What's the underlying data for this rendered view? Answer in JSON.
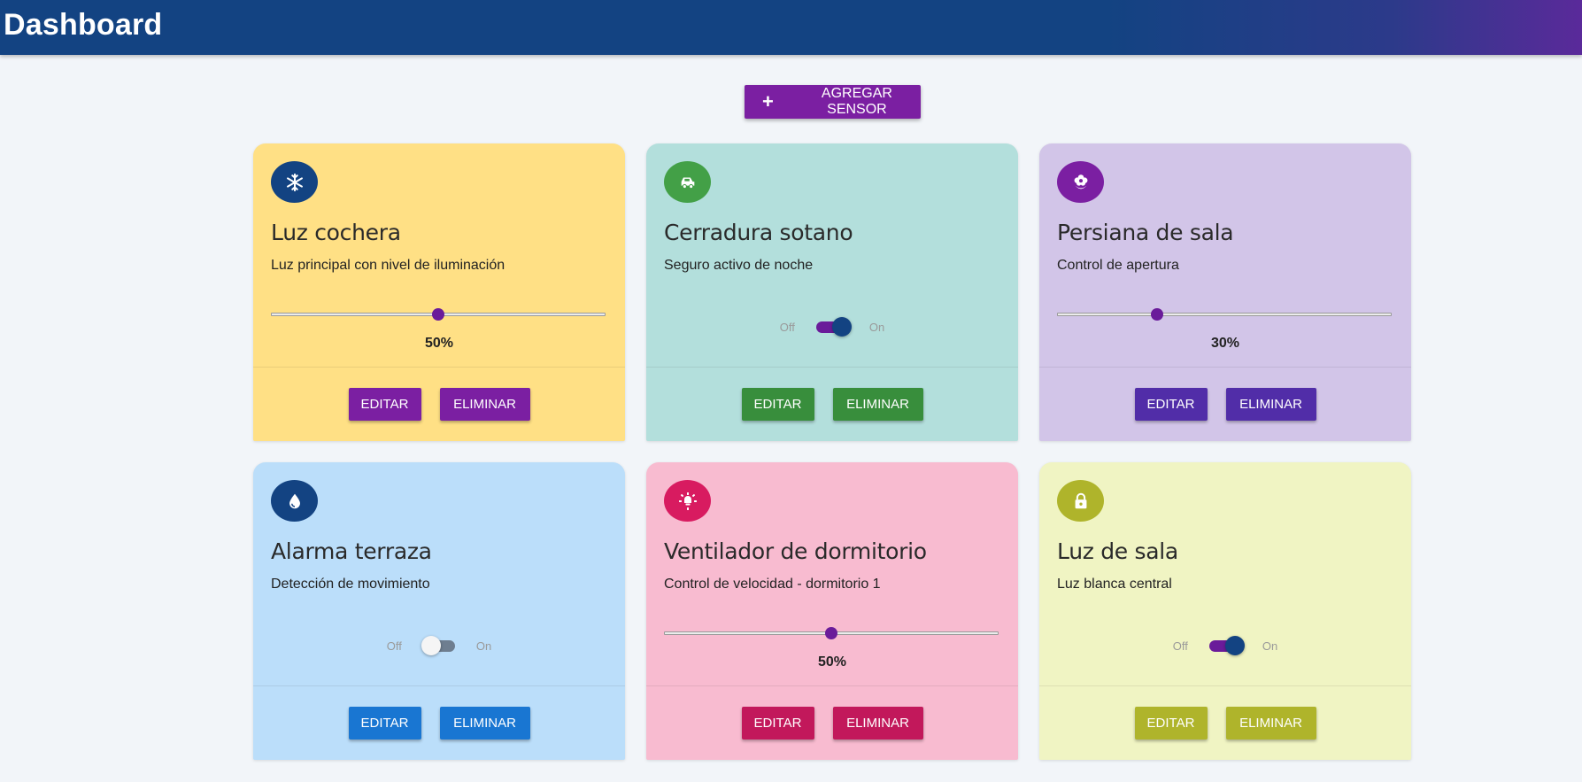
{
  "header": {
    "title": "Dashboard"
  },
  "toolbar": {
    "add_icon": "plus-icon",
    "add_label": "AGREGAR SENSOR",
    "add_color": "#7b1fa2"
  },
  "common": {
    "off_label": "Off",
    "on_label": "On",
    "edit_label": "EDITAR",
    "delete_label": "ELIMINAR"
  },
  "cards": [
    {
      "title": "Luz cochera",
      "description": "Luz principal con nivel de iluminación",
      "icon": "snowflake-icon",
      "card_bg": "#ffe085",
      "icon_bg": "#134382",
      "button_color": "#7b1fa2",
      "control": "slider",
      "value": 50,
      "value_label": "50%"
    },
    {
      "title": "Cerradura sotano",
      "description": "Seguro activo de noche",
      "icon": "car-icon",
      "card_bg": "#b3dfdc",
      "icon_bg": "#43a047",
      "button_color": "#388e3c",
      "control": "switch",
      "state": "on"
    },
    {
      "title": "Persiana de sala",
      "description": "Control de apertura",
      "icon": "flower-icon",
      "card_bg": "#d2c5e8",
      "icon_bg": "#7b1fa2",
      "button_color": "#512da8",
      "control": "slider",
      "value": 30,
      "value_label": "30%"
    },
    {
      "title": "Alarma terraza",
      "description": "Detección de movimiento",
      "icon": "water-drop-icon",
      "card_bg": "#bbdefa",
      "icon_bg": "#134382",
      "button_color": "#1976d2",
      "control": "switch",
      "state": "off"
    },
    {
      "title": "Ventilador de dormitorio",
      "description": "Control de velocidad - dormitorio 1",
      "icon": "lightbulb-icon",
      "card_bg": "#f8bbd0",
      "icon_bg": "#d81b60",
      "button_color": "#c2185b",
      "control": "slider",
      "value": 50,
      "value_label": "50%"
    },
    {
      "title": "Luz de sala",
      "description": "Luz blanca central",
      "icon": "lock-icon",
      "card_bg": "#f0f4c3",
      "icon_bg": "#afb42b",
      "button_color": "#afb42b",
      "control": "switch",
      "state": "on"
    }
  ]
}
